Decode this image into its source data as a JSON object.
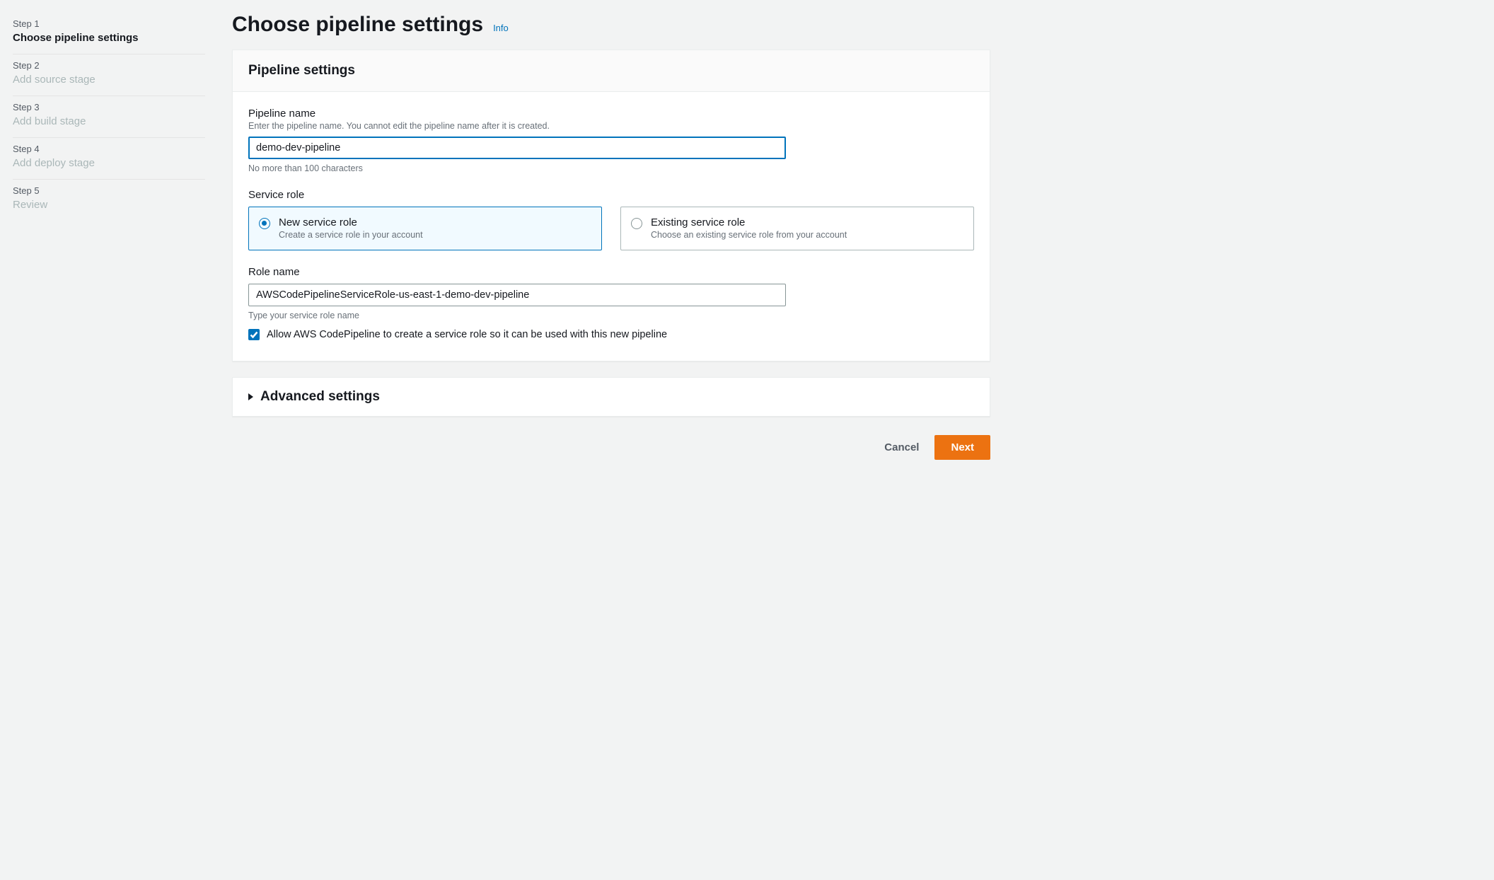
{
  "steps": [
    {
      "num": "Step 1",
      "title": "Choose pipeline settings",
      "active": true
    },
    {
      "num": "Step 2",
      "title": "Add source stage",
      "active": false
    },
    {
      "num": "Step 3",
      "title": "Add build stage",
      "active": false
    },
    {
      "num": "Step 4",
      "title": "Add deploy stage",
      "active": false
    },
    {
      "num": "Step 5",
      "title": "Review",
      "active": false
    }
  ],
  "header": {
    "title": "Choose pipeline settings",
    "info": "Info"
  },
  "panel": {
    "title": "Pipeline settings"
  },
  "pipeline_name": {
    "label": "Pipeline name",
    "desc": "Enter the pipeline name. You cannot edit the pipeline name after it is created.",
    "value": "demo-dev-pipeline",
    "hint": "No more than 100 characters"
  },
  "service_role": {
    "label": "Service role",
    "new": {
      "title": "New service role",
      "desc": "Create a service role in your account"
    },
    "existing": {
      "title": "Existing service role",
      "desc": "Choose an existing service role from your account"
    }
  },
  "role_name": {
    "label": "Role name",
    "value": "AWSCodePipelineServiceRole-us-east-1-demo-dev-pipeline",
    "hint": "Type your service role name",
    "allow_create": "Allow AWS CodePipeline to create a service role so it can be used with this new pipeline"
  },
  "advanced": {
    "title": "Advanced settings"
  },
  "footer": {
    "cancel": "Cancel",
    "next": "Next"
  }
}
